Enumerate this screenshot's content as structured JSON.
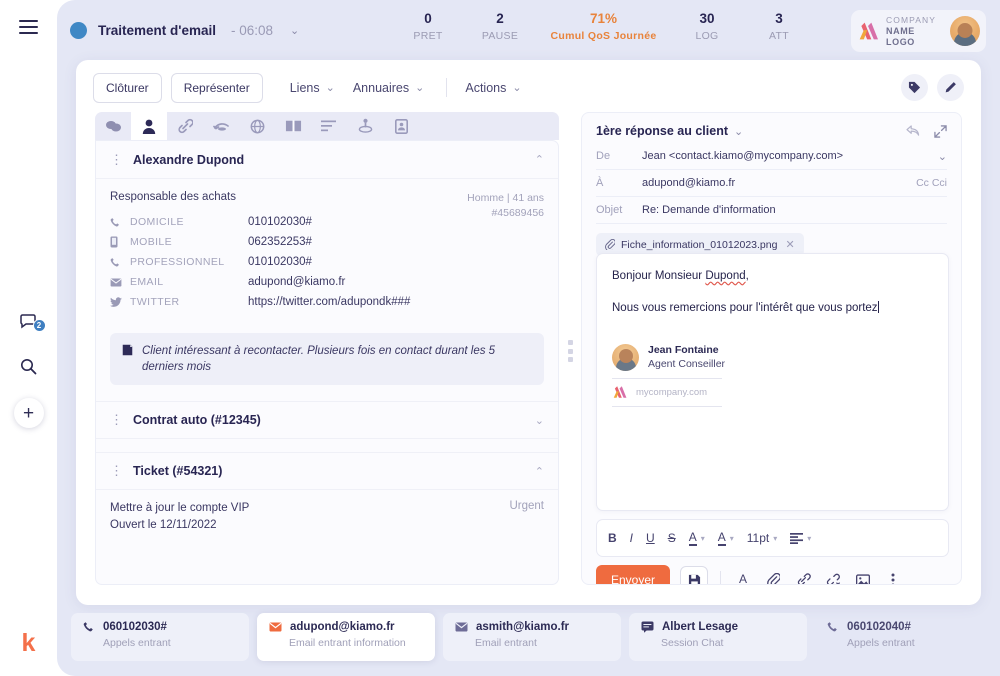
{
  "rail": {
    "menu_icon": "hamburger-icon",
    "chat_icon": "chat-icon",
    "chat_badge": "2",
    "search_icon": "search-icon",
    "add_label": "+",
    "logo": "k"
  },
  "topbar": {
    "status_title": "Traitement d'email",
    "status_time": "- 06:08",
    "status_color": "#3f88c5",
    "stats": [
      {
        "value": "0",
        "label": "PRET"
      },
      {
        "value": "2",
        "label": "PAUSE"
      },
      {
        "value": "71%",
        "label": "Cumul QoS Journée",
        "accent": "#e8833b"
      },
      {
        "value": "30",
        "label": "LOG"
      },
      {
        "value": "3",
        "label": "ATT"
      }
    ],
    "brand_line1": "COMPANY",
    "brand_line2": "NAME LOGO"
  },
  "actionbar": {
    "cloturer": "Clôturer",
    "representer": "Représenter",
    "liens": "Liens",
    "annuaires": "Annuaires",
    "actions": "Actions",
    "tag_icon": "tag-icon",
    "edit_icon": "pencil-icon"
  },
  "tabstrip": {
    "tabs": [
      {
        "name": "conversations-icon"
      },
      {
        "name": "contact-icon",
        "active": true
      },
      {
        "name": "link-icon"
      },
      {
        "name": "history-icon"
      },
      {
        "name": "globe-icon"
      },
      {
        "name": "book-icon"
      },
      {
        "name": "list-icon"
      },
      {
        "name": "location-icon"
      },
      {
        "name": "id-card-icon"
      }
    ]
  },
  "contact": {
    "name": "Alexandre Dupond",
    "role": "Responsable des achats",
    "meta_line1": "Homme | 41 ans",
    "meta_line2": "#45689456",
    "fields": [
      {
        "icon": "phone-icon",
        "label": "DOMICILE",
        "value": "010102030#"
      },
      {
        "icon": "mobile-icon",
        "label": "MOBILE",
        "value": "062352253#"
      },
      {
        "icon": "phone-icon",
        "label": "PROFESSIONNEL",
        "value": "010102030#"
      },
      {
        "icon": "mail-icon",
        "label": "EMAIL",
        "value": "adupond@kiamo.fr"
      },
      {
        "icon": "twitter-icon",
        "label": "TWITTER",
        "value": "https://twitter.com/adupondk###"
      }
    ],
    "note_icon": "note-icon",
    "note": "Client intéressant à recontacter. Plusieurs fois en contact durant les 5 derniers mois"
  },
  "sections": {
    "contrat_title": "Contrat auto (#12345)",
    "ticket_title": "Ticket (#54321)",
    "ticket_line1": "Mettre à jour le compte VIP",
    "ticket_line2": "Ouvert le 12/11/2022",
    "ticket_flag": "Urgent"
  },
  "mail": {
    "panel_title": "1ère réponse au client",
    "reply_icon": "reply-all-icon",
    "expand_icon": "expand-icon",
    "from_label": "De",
    "from_value": "Jean <contact.kiamo@mycompany.com>",
    "to_label": "À",
    "to_value": "adupond@kiamo.fr",
    "cc_label": "Cc Cci",
    "subject_label": "Objet",
    "subject_value": "Re: Demande d'information",
    "attachment": "Fiche_information_01012023.png",
    "attachment_icon": "paperclip-icon",
    "body_line1": "Bonjour Monsieur ",
    "body_line1_misspell": "Dupond",
    "body_line1_end": ",",
    "body_line2": "Nous vous remercions pour l'intérêt que vous portez",
    "sig_name": "Jean Fontaine",
    "sig_role": "Agent Conseiller",
    "sig_site": "mycompany.com"
  },
  "format_toolbar": {
    "bold": "B",
    "italic": "I",
    "underline": "U",
    "strike": "S",
    "font_color": "A",
    "highlight": "A",
    "font_size": "11pt",
    "align_icon": "align-left-icon"
  },
  "send_toolbar": {
    "send_label": "Envoyer",
    "save_icon": "floppy-disk-icon",
    "text_icon": "text-color-icon",
    "attach_icon": "paperclip-icon",
    "link_icon": "link-icon",
    "unlink_icon": "unlink-icon",
    "image_icon": "image-icon",
    "more_icon": "kebab-menu-icon"
  },
  "bottom_tabs": [
    {
      "icon": "phone-icon",
      "title": "060102030#",
      "subtitle": "Appels entrant",
      "state": "idle"
    },
    {
      "icon": "mail-icon",
      "title": "adupond@kiamo.fr",
      "subtitle": "Email entrant information",
      "state": "active"
    },
    {
      "icon": "mail-icon",
      "title": "asmith@kiamo.fr",
      "subtitle": "Email entrant",
      "state": "idle"
    },
    {
      "icon": "chat-icon",
      "title": "Albert Lesage",
      "subtitle": "Session Chat",
      "state": "idle"
    },
    {
      "icon": "phone-icon",
      "title": "060102040#",
      "subtitle": "Appels entrant",
      "state": "plain"
    }
  ],
  "colors": {
    "accent": "#ef6b3f",
    "brand_blue": "#3f88c5",
    "page_bg": "#e4e7f5",
    "text_dark": "#282552",
    "text_muted": "#a1a1bb"
  }
}
